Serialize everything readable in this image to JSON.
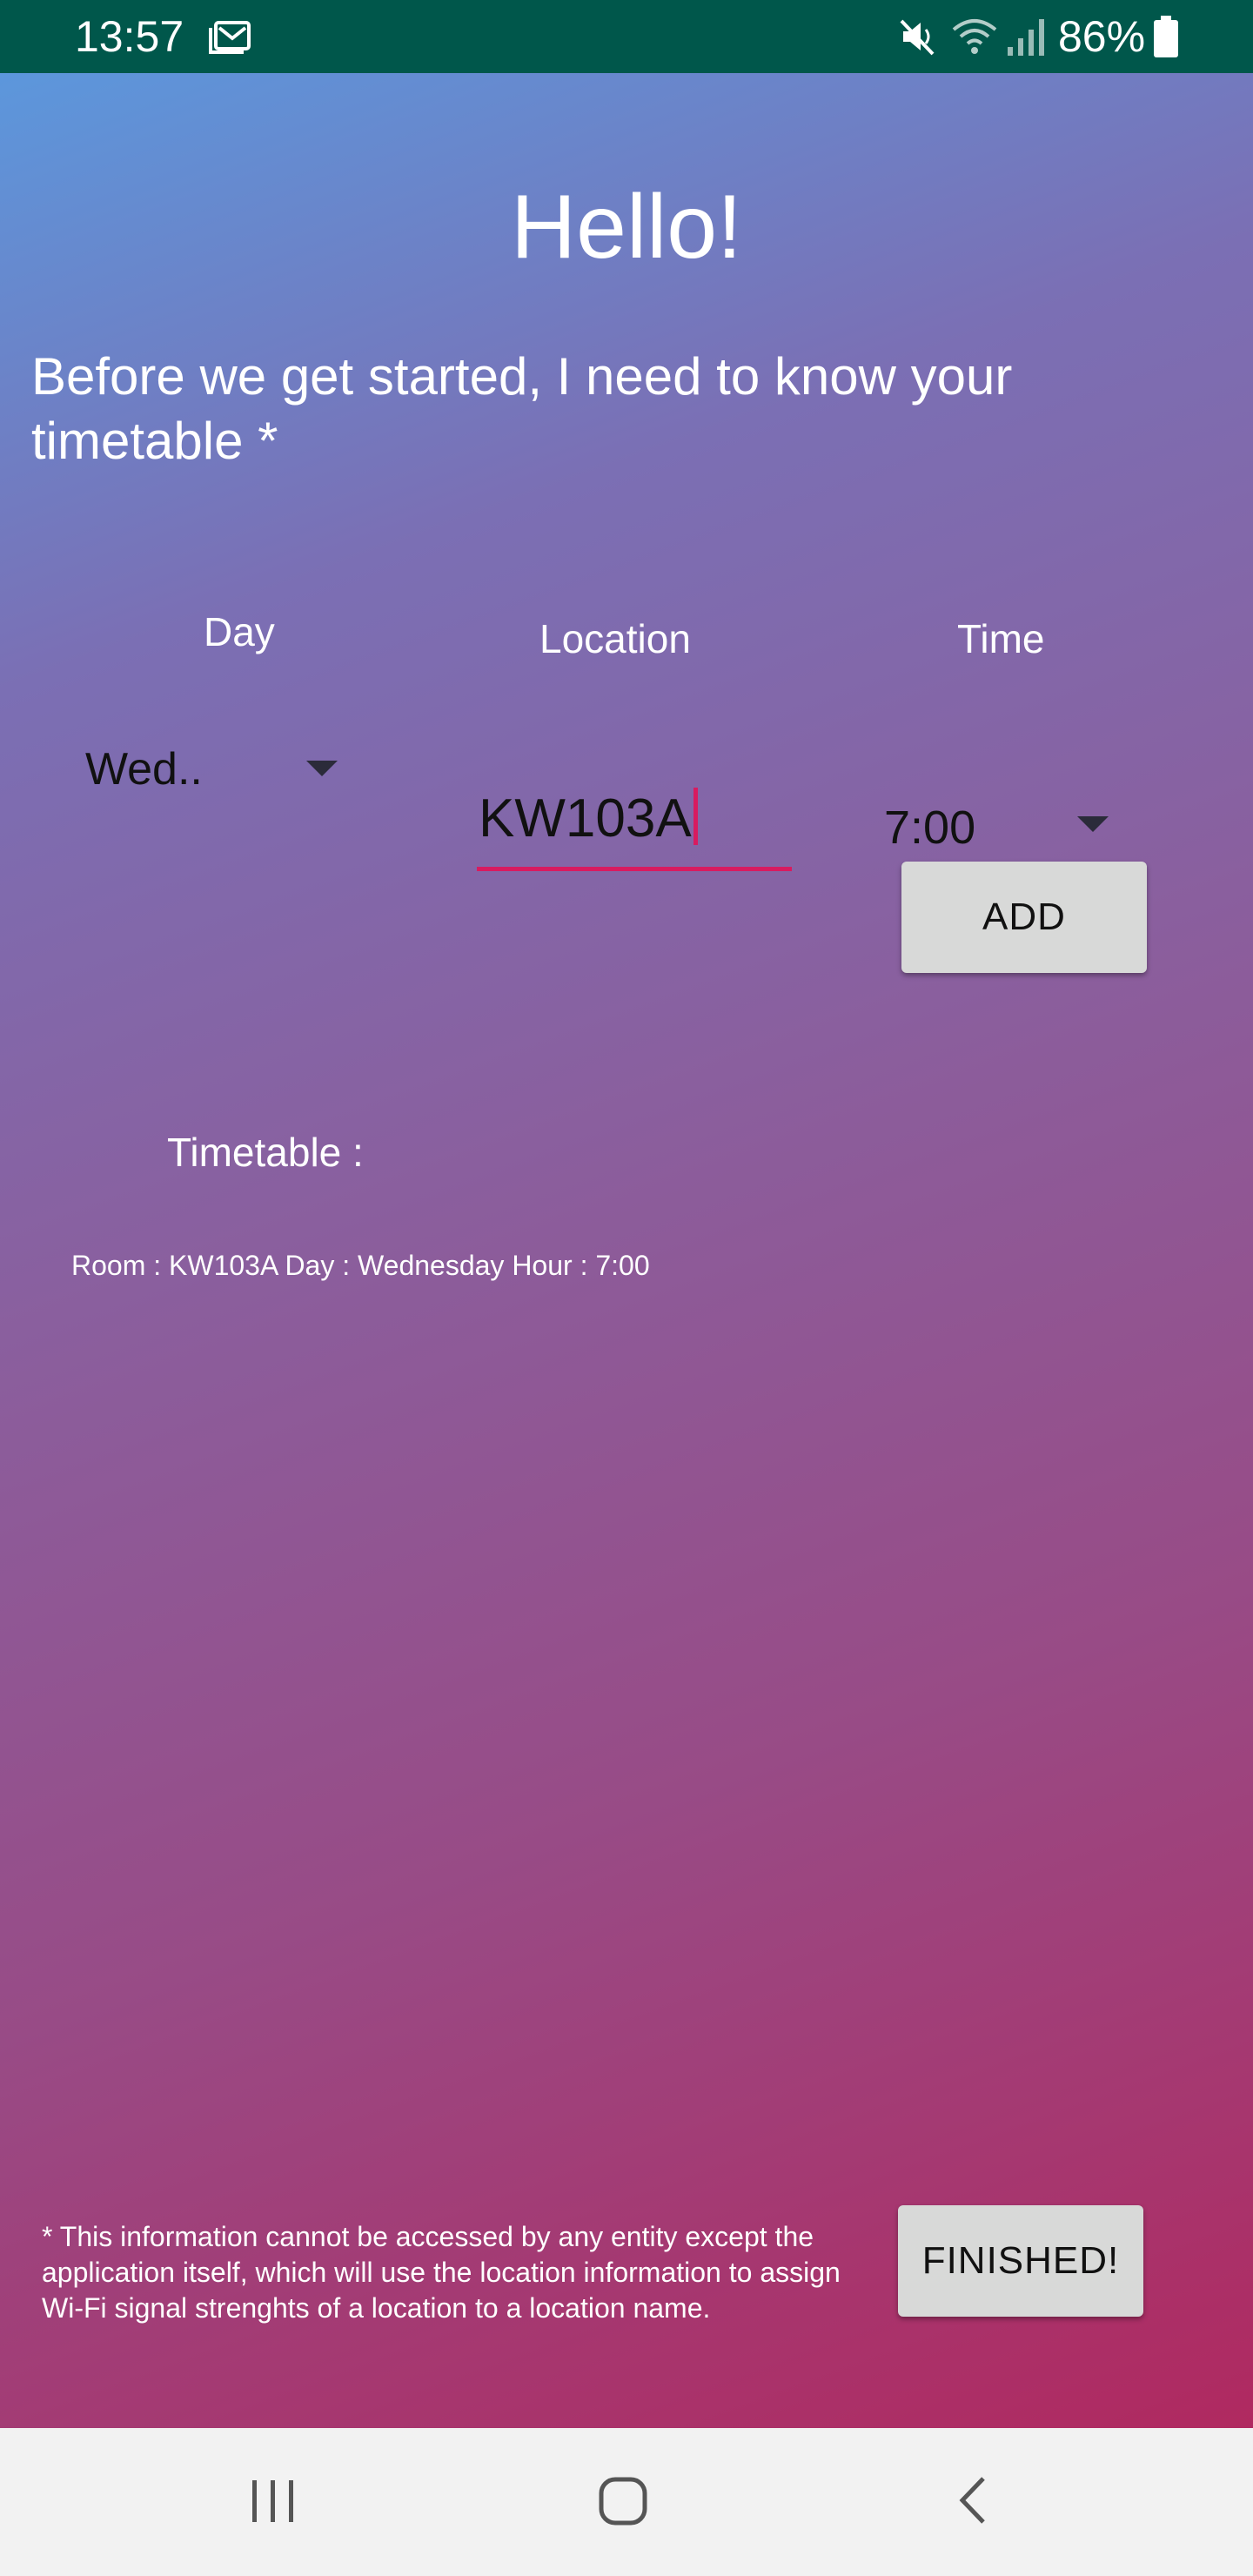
{
  "status_bar": {
    "time": "13:57",
    "battery": "86%",
    "icons": [
      "mail-icon",
      "mute-icon",
      "wifi-icon",
      "signal-icon",
      "battery-icon"
    ]
  },
  "header": {
    "title": "Hello!",
    "intro": "Before we get started, I need to know your timetable *"
  },
  "form": {
    "day_label": "Day",
    "location_label": "Location",
    "time_label": "Time",
    "day_value": "Wed..",
    "location_value": "KW103A",
    "time_value": "7:00",
    "add_label": "ADD"
  },
  "timetable": {
    "label": "Timetable :",
    "entries": [
      "Room : KW103A Day : Wednesday Hour : 7:00"
    ]
  },
  "footer": {
    "note": "* This information cannot be accessed by any entity except the application itself, which will use the location information to assign Wi-Fi signal strenghts of a location to a location name.",
    "finished_label": "FINISHED!"
  },
  "colors": {
    "status_bar": "#00574b",
    "accent": "#d81b60",
    "button_bg": "#d8d9d8",
    "gradient_start": "#5c97dc",
    "gradient_end": "#b02960"
  }
}
